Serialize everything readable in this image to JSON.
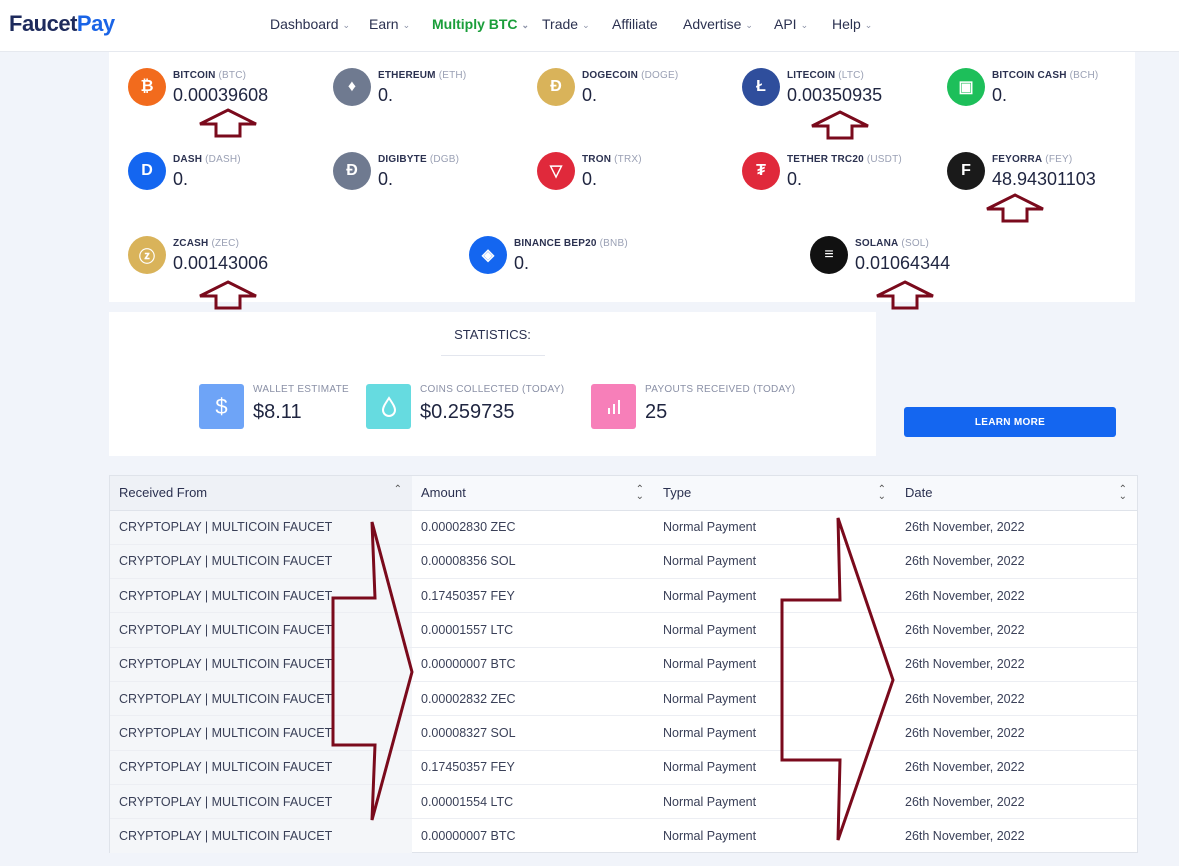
{
  "brand": {
    "part1": "Faucet",
    "part2": "Pay"
  },
  "nav": [
    {
      "label": "Dashboard",
      "caret": true,
      "active": false
    },
    {
      "label": "Earn",
      "caret": true,
      "active": false
    },
    {
      "label": "Multiply BTC",
      "caret": true,
      "active": true
    },
    {
      "label": "Trade",
      "caret": true,
      "active": false
    },
    {
      "label": "Affiliate",
      "caret": false,
      "active": false
    },
    {
      "label": "Advertise",
      "caret": true,
      "active": false
    },
    {
      "label": "API",
      "caret": true,
      "active": false
    },
    {
      "label": "Help",
      "caret": true,
      "active": false
    }
  ],
  "coins": [
    {
      "name": "BITCOIN",
      "symbol": "(BTC)",
      "value": "0.00039608",
      "icon": "bitcoin-icon",
      "color": "#f26b1d",
      "glyph": "₿"
    },
    {
      "name": "ETHEREUM",
      "symbol": "(ETH)",
      "value": "0.",
      "icon": "ethereum-icon",
      "color": "#6f7a90",
      "glyph": "♦"
    },
    {
      "name": "DOGECOIN",
      "symbol": "(DOGE)",
      "value": "0.",
      "icon": "dogecoin-icon",
      "color": "#d9b35a",
      "glyph": "Ð"
    },
    {
      "name": "LITECOIN",
      "symbol": "(LTC)",
      "value": "0.00350935",
      "icon": "litecoin-icon",
      "color": "#2f4e9c",
      "glyph": "Ł"
    },
    {
      "name": "BITCOIN CASH",
      "symbol": "(BCH)",
      "value": "0.",
      "icon": "bitcoin-cash-icon",
      "color": "#1dbf5a",
      "glyph": "▣"
    },
    {
      "name": "DASH",
      "symbol": "(DASH)",
      "value": "0.",
      "icon": "dash-icon",
      "color": "#1466f0",
      "glyph": "D"
    },
    {
      "name": "DIGIBYTE",
      "symbol": "(DGB)",
      "value": "0.",
      "icon": "digibyte-icon",
      "color": "#6f7a90",
      "glyph": "Đ"
    },
    {
      "name": "TRON",
      "symbol": "(TRX)",
      "value": "0.",
      "icon": "tron-icon",
      "color": "#e0293b",
      "glyph": "▽"
    },
    {
      "name": "TETHER TRC20",
      "symbol": "(USDT)",
      "value": "0.",
      "icon": "tether-icon",
      "color": "#e0293b",
      "glyph": "₮"
    },
    {
      "name": "FEYORRA",
      "symbol": "(FEY)",
      "value": "48.94301103",
      "icon": "feyorra-icon",
      "color": "#1a1a1a",
      "glyph": "F"
    },
    {
      "name": "ZCASH",
      "symbol": "(ZEC)",
      "value": "0.00143006",
      "icon": "zcash-icon",
      "color": "#d9b35a",
      "glyph": "ⓩ"
    },
    {
      "name": "BINANCE BEP20",
      "symbol": "(BNB)",
      "value": "0.",
      "icon": "binance-icon",
      "color": "#1466f0",
      "glyph": "◈"
    },
    {
      "name": "SOLANA",
      "symbol": "(SOL)",
      "value": "0.01064344",
      "icon": "solana-icon",
      "color": "#111111",
      "glyph": "≡"
    }
  ],
  "statistics": {
    "title": "STATISTICS:",
    "items": [
      {
        "label": "WALLET ESTIMATE",
        "value": "$8.11",
        "icon": "dollar-icon",
        "color": "#6ea4f7"
      },
      {
        "label": "COINS COLLECTED (TODAY)",
        "value": "$0.259735",
        "icon": "drop-icon",
        "color": "#66dbe0"
      },
      {
        "label": "PAYOUTS RECEIVED (TODAY)",
        "value": "25",
        "icon": "bar-chart-icon",
        "color": "#f77fb9"
      }
    ]
  },
  "learn_more": "LEARN MORE",
  "table": {
    "headers": [
      "Received From",
      "Amount",
      "Type",
      "Date"
    ],
    "rows": [
      [
        "CRYPTOPLAY | MULTICOIN FAUCET",
        "0.00002830 ZEC",
        "Normal Payment",
        "26th November, 2022"
      ],
      [
        "CRYPTOPLAY | MULTICOIN FAUCET",
        "0.00008356 SOL",
        "Normal Payment",
        "26th November, 2022"
      ],
      [
        "CRYPTOPLAY | MULTICOIN FAUCET",
        "0.17450357 FEY",
        "Normal Payment",
        "26th November, 2022"
      ],
      [
        "CRYPTOPLAY | MULTICOIN FAUCET",
        "0.00001557 LTC",
        "Normal Payment",
        "26th November, 2022"
      ],
      [
        "CRYPTOPLAY | MULTICOIN FAUCET",
        "0.00000007 BTC",
        "Normal Payment",
        "26th November, 2022"
      ],
      [
        "CRYPTOPLAY | MULTICOIN FAUCET",
        "0.00002832 ZEC",
        "Normal Payment",
        "26th November, 2022"
      ],
      [
        "CRYPTOPLAY | MULTICOIN FAUCET",
        "0.00008327 SOL",
        "Normal Payment",
        "26th November, 2022"
      ],
      [
        "CRYPTOPLAY | MULTICOIN FAUCET",
        "0.17450357 FEY",
        "Normal Payment",
        "26th November, 2022"
      ],
      [
        "CRYPTOPLAY | MULTICOIN FAUCET",
        "0.00001554 LTC",
        "Normal Payment",
        "26th November, 2022"
      ],
      [
        "CRYPTOPLAY | MULTICOIN FAUCET",
        "0.00000007 BTC",
        "Normal Payment",
        "26th November, 2022"
      ]
    ]
  },
  "annotation_color": "#7a0a1c"
}
